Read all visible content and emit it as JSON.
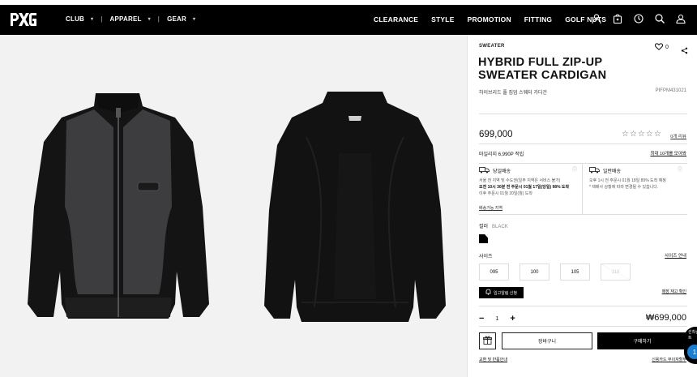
{
  "header": {
    "left_nav": [
      {
        "label": "CLUB"
      },
      {
        "label": "APPAREL"
      },
      {
        "label": "GEAR"
      }
    ],
    "right_nav": [
      "CLEARANCE",
      "STYLE",
      "PROMOTION",
      "FITTING",
      "GOLF NUTS"
    ],
    "icons": [
      "user-icon",
      "bag-icon",
      "history-icon",
      "search-icon",
      "account-icon"
    ]
  },
  "product": {
    "category": "SWEATER",
    "title": "HYBRID FULL ZIP-UP SWEATER CARDIGAN",
    "subtitle": "하이브리드 풀 집업 스웨터 가디건",
    "code": "PIFPM431021",
    "wish_count": "0",
    "price": "699,000",
    "review_link": "0개 리뷰",
    "points": "마일리지 6,990P 적립",
    "coupon_link": "최대 10개를 모아봐",
    "shipping_same_day": {
      "title": "당일배송",
      "line1": "서울 전 지역 및 수도권(일부 지역은 서비스 불가)",
      "line2": "오전 10시 30분 전 주문시 01월 17일(당일) 98% 도착",
      "line3": "이후 주문시 01월 20일(월) 도착"
    },
    "shipping_normal": {
      "title": "일반배송",
      "line1": "오후 1시 전 주문시 01월 18일 89% 도착 예정",
      "line2": "* 택배사 상황에 따라 변경될 수 있습니다."
    },
    "area_link": "배송가능 지역",
    "color_label": "컬러",
    "color_value": "BLACK",
    "size_label": "사이즈",
    "size_guide": "사이즈 안내",
    "sizes": [
      "095",
      "100",
      "105",
      "110"
    ],
    "restock_button": "입고알림 신청",
    "stock_check": "매장 재고 확인",
    "quantity": "1",
    "total": "₩699,000",
    "cart_button": "장바구니",
    "buy_button": "구매하기",
    "returns_link": "교환 및 반품안내",
    "card_link": "신용카드 무이자할부",
    "float_text": "선착순 이벤트",
    "float_badge": "1"
  },
  "colors": {
    "accent": "#000000",
    "gallery_bg": "#f2f2f2",
    "badge": "#1a7fd0"
  }
}
